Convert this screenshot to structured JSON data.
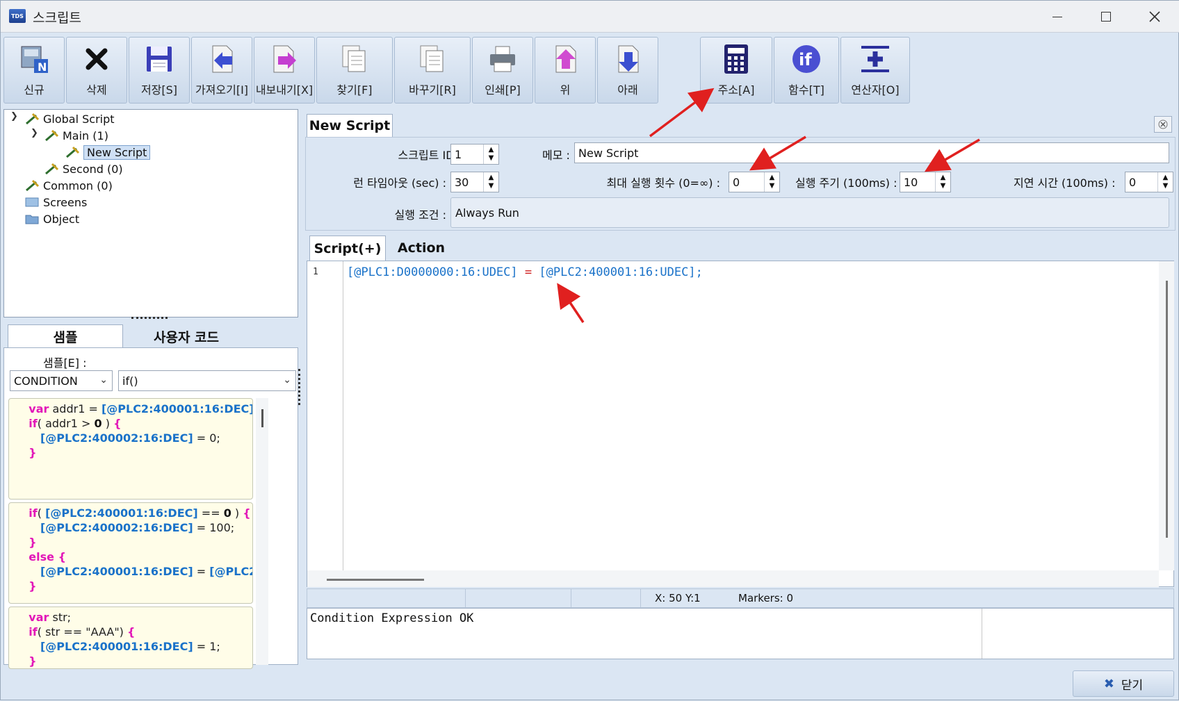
{
  "window": {
    "title": "스크립트",
    "logo_text": "TDS"
  },
  "toolbar": {
    "new": "신규",
    "delete": "삭제",
    "save": "저장[S]",
    "import": "가져오기[I]",
    "export": "내보내기[X]",
    "find": "찾기[F]",
    "replace": "바꾸기[R]",
    "print": "인쇄[P]",
    "up": "위",
    "down": "아래",
    "address": "주소[A]",
    "function": "함수[T]",
    "operator": "연산자[O]"
  },
  "tree": {
    "global": "Global Script",
    "main": "Main (1)",
    "new_script": "New Script",
    "second": "Second (0)",
    "common": "Common (0)",
    "screens": "Screens",
    "object": "Object"
  },
  "sample": {
    "tab_sample": "샘플",
    "tab_user": "사용자 코드",
    "label": "샘플[E] :",
    "category": "CONDITION",
    "item": "if()"
  },
  "doc": {
    "tab": "New Script"
  },
  "props": {
    "script_id_label": "스크립트 ID :",
    "script_id": "1",
    "memo_label": "메모 :",
    "memo": "New Script",
    "timeout_label": "런 타임아웃 (sec) :",
    "timeout": "30",
    "max_runs_label": "최대 실행 횟수  (0=∞) :",
    "max_runs": "0",
    "period_label": "실행 주기 (100ms) :",
    "period": "10",
    "delay_label": "지연 시간 (100ms) :",
    "delay": "0",
    "condition_label": "실행 조건 :",
    "condition": "Always Run"
  },
  "editor": {
    "tab_script": "Script(+)",
    "tab_action": "Action",
    "line_number": "1",
    "lhs": "[@PLC1:D0000000:16:UDEC]",
    "op": "=",
    "rhs": "[@PLC2:400001:16:UDEC]",
    "end": ";"
  },
  "status": {
    "cursor": "X: 50  Y:1",
    "markers": "Markers: 0"
  },
  "output": {
    "message": "Condition Expression OK"
  },
  "footer": {
    "close": "닫기"
  },
  "colors": {
    "accent": "#1a72c9",
    "keyword": "#e216b8",
    "operator": "#cf1b1b",
    "arrow": "#e0201f"
  }
}
